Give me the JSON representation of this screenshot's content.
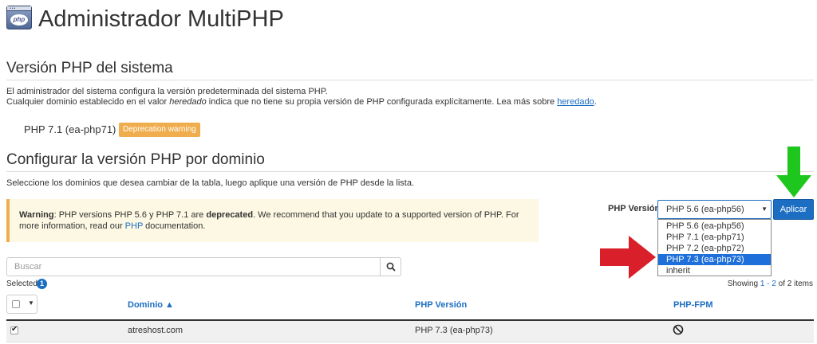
{
  "header": {
    "title": "Administrador MultiPHP",
    "app_icon_text": "php"
  },
  "system_section": {
    "title": "Versión PHP del sistema",
    "desc_line1": "El administrador del sistema configura la versión predeterminada del sistema PHP.",
    "desc_line2_a": "Cualquier dominio establecido en el valor ",
    "desc_line2_em": "heredado",
    "desc_line2_b": " indica que no tiene su propia versión de PHP configurada explícitamente. Lea más sobre ",
    "desc_line2_link": "heredado",
    "desc_line2_end": ".",
    "current_version": "PHP 7.1 (ea-php71)",
    "deprecation_badge": "Deprecation warning"
  },
  "domain_section": {
    "title": "Configurar la versión PHP por dominio",
    "description": "Seleccione los dominios que desea cambiar de la tabla, luego aplique una versión de PHP desde la lista.",
    "warning": {
      "bold_prefix": "Warning",
      "text_a": ": PHP versions PHP 5.6 y PHP 7.1 are ",
      "bold_mid": "deprecated",
      "text_b": ". We recommend that you update to a supported version of PHP. For more information, read our ",
      "link": "PHP",
      "text_c": " documentation."
    },
    "php_version_label": "PHP Versión",
    "select_value": "PHP 5.6 (ea-php56)",
    "options": [
      "PHP 5.6 (ea-php56)",
      "PHP 7.1 (ea-php71)",
      "PHP 7.2 (ea-php72)",
      "PHP 7.3 (ea-php73)",
      "inherit"
    ],
    "highlighted_option": "PHP 7.3 (ea-php73)",
    "apply_button": "Aplicar",
    "search_placeholder": "Buscar",
    "selected_label": "Selected",
    "selected_count": "1",
    "showing": {
      "prefix": "Showing ",
      "range": "1 - 2",
      "suffix": " of 2 items"
    }
  },
  "table": {
    "columns": [
      "Dominio ▲",
      "PHP Versión",
      "PHP-FPM"
    ],
    "rows": [
      {
        "checked": true,
        "domain": "atreshost.com",
        "php_version": "PHP 7.3 (ea-php73)",
        "php_fpm": "disabled"
      }
    ]
  },
  "annotations": {
    "arrow_green_color": "#1ec71e",
    "arrow_red_color": "#d9202a",
    "arrow_blue_color": "#0c4a8a"
  },
  "colors": {
    "accent": "#1b6ec2",
    "warning": "#f0ad4e",
    "warning_bg": "#fcf8e3",
    "option_highlight": "#1e6fd9"
  }
}
